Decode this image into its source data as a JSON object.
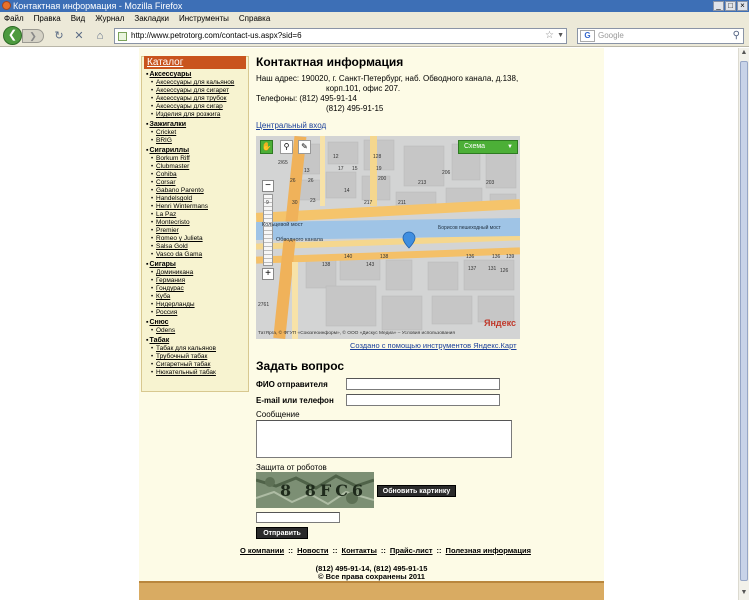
{
  "browser": {
    "title": "Контактная информация - Mozilla Firefox",
    "menu": [
      "Файл",
      "Правка",
      "Вид",
      "Журнал",
      "Закладки",
      "Инструменты",
      "Справка"
    ],
    "url": "http://www.petrotorg.com/contact-us.aspx?sid=6",
    "search_placeholder": "Google",
    "window_buttons": [
      "_",
      "□",
      "×"
    ]
  },
  "sidebar": {
    "title": "Каталог",
    "categories": [
      {
        "name": "Аксессуары",
        "items": [
          "Аксессуары для кальянов",
          "Аксессуары для сигарет",
          "Аксессуары для трубок",
          "Аксессуары для сигар",
          "Изделия для розжига"
        ]
      },
      {
        "name": "Зажигалки",
        "items": [
          "Cricket",
          "BRIG"
        ]
      },
      {
        "name": "Сигариллы",
        "items": [
          "Borkum Riff",
          "Clubmaster",
          "Cohiba",
          "Corsar",
          "Gabano Parento",
          "Handelsgold",
          "Henri Wintermans",
          "La Paz",
          "Montecristo",
          "Premier",
          "Romeo y Julieta",
          "Salsa Gold",
          "Vasco da Gama"
        ]
      },
      {
        "name": "Сигары",
        "items": [
          "Доминикана",
          "Германия",
          "Гондурас",
          "Куба",
          "Нидерланды",
          "Россия"
        ]
      },
      {
        "name": "Снюс",
        "items": [
          "Odens"
        ]
      },
      {
        "name": "Табак",
        "items": [
          "Табак для кальянов",
          "Трубочный табак",
          "Сигаретный табак",
          "Нюхательный табак"
        ]
      }
    ]
  },
  "content": {
    "title": "Контактная информация",
    "address_label": "Наш адрес:",
    "address_line1": "190020, г. Санкт-Петербург, наб. Обводного канала, д.138,",
    "address_line2": "корп.101, офис 207.",
    "phones_label": "Телефоны:",
    "phone1": "(812) 495-91-14",
    "phone2": "(812) 495-91-15",
    "entrance_link": "Центральный вход"
  },
  "map": {
    "scheme_button": "Схема",
    "street_labels": [
      "Кольцевой мост",
      "Обводного канала",
      "Борисов пешеходный мост",
      "Обводного канала"
    ],
    "house_numbers": [
      "2/65",
      "12",
      "128",
      "13",
      "17",
      "15",
      "19",
      "200",
      "206",
      "203",
      "14",
      "213",
      "211",
      "217",
      "26",
      "26",
      "9",
      "30",
      "23",
      "140",
      "138",
      "136",
      "136",
      "139",
      "137",
      "131",
      "143",
      "138",
      "126",
      "2761"
    ],
    "copyright": "ТатЯрга, © ФГУП «Союзгеоинформ», © ООО «Дискус Медиа» – Условия использования",
    "brand": "Яндекс",
    "credit_link": "Создано с помощью инструментов Яндекс.Карт"
  },
  "form": {
    "title": "Задать вопрос",
    "name_label": "ФИО отправителя",
    "email_label": "E-mail или телефон",
    "message_label": "Сообщение",
    "captcha_label": "Защита от роботов",
    "captcha_text": "8 8FC6",
    "refresh_button": "Обновить картинку",
    "submit_button": "Отправить"
  },
  "footer": {
    "links": [
      "О компании",
      "Новости",
      "Контакты",
      "Прайс-лист",
      "Полезная информация"
    ],
    "phones": "(812) 495-91-14, (812) 495-91-15",
    "copyright": "© Все права сохранены 2011"
  }
}
